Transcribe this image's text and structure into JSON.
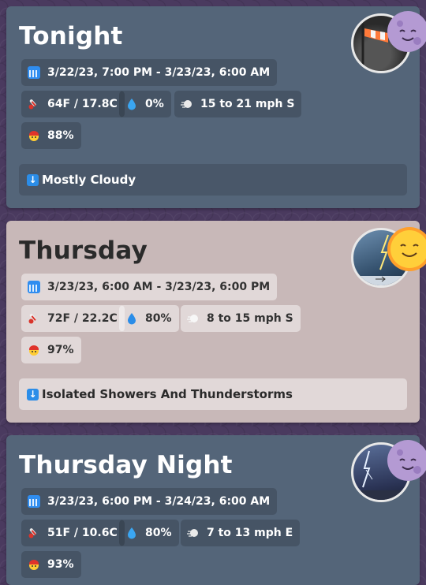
{
  "periods": [
    {
      "name": "Tonight",
      "time_range": "3/22/23, 7:00 PM - 3/23/23, 6:00 AM",
      "temperature": "64F / 17.8C",
      "precipitation": "0%",
      "wind": "15 to 21 mph S",
      "humidity": "88%",
      "forecast": "Mostly Cloudy",
      "icon": "windsock-image",
      "badge": "moon-face-emoji"
    },
    {
      "name": "Thursday",
      "time_range": "3/23/23, 6:00 AM - 3/23/23, 6:00 PM",
      "temperature": "72F / 22.2C",
      "precipitation": "80%",
      "wind": "8 to 15 mph S",
      "humidity": "97%",
      "forecast": "Isolated Showers And Thunderstorms",
      "icon": "lightning-image",
      "badge": "sun-face-emoji"
    },
    {
      "name": "Thursday Night",
      "time_range": "3/23/23, 6:00 PM - 3/24/23, 6:00 AM",
      "temperature": "51F / 10.6C",
      "precipitation": "80%",
      "wind": "7 to 13 mph E",
      "humidity": "93%",
      "icon": "lightning-image",
      "badge": "moon-face-emoji"
    }
  ],
  "colors": {
    "night_card": "#546579",
    "day_card": "#c8b8b8",
    "accent_blue": "#2b8de8",
    "background": "#4a3a5f"
  }
}
